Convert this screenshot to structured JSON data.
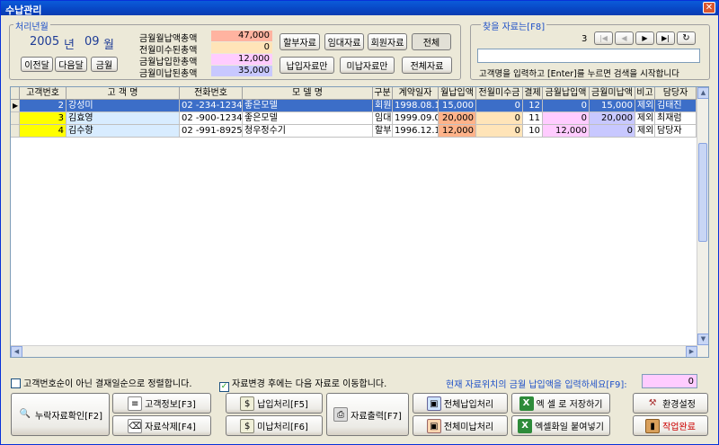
{
  "window": {
    "title": "수납관리",
    "close_glyph": "✕"
  },
  "period": {
    "group_label": "처리년월",
    "year": "2005",
    "year_unit": "년",
    "month": "09",
    "month_unit": "월",
    "prev_month_btn": "이전달",
    "next_month_btn": "다음달",
    "this_month_btn": "금월"
  },
  "summary": {
    "rows": [
      {
        "label": "금월월납액총액",
        "value": "47,000",
        "color": "#ffb3a0"
      },
      {
        "label": "전월미수된총액",
        "value": "0",
        "color": "#ffe4b8"
      },
      {
        "label": "금월납입한총액",
        "value": "12,000",
        "color": "#ffccff"
      },
      {
        "label": "금월미납된총액",
        "value": "35,000",
        "color": "#c8c8ff"
      }
    ]
  },
  "filters": {
    "installment": "할부자료",
    "rental": "임대자료",
    "member": "회원자료",
    "all": "전체",
    "paid_only": "납입자료만",
    "unpaid_only": "미납자료만",
    "all_data": "전체자료"
  },
  "search": {
    "group_label": "찾을 자료는[F8]",
    "counter": "3",
    "nav_first": "|◀",
    "nav_prev": "◀",
    "nav_next": "▶",
    "nav_last": "▶|",
    "nav_refresh": "↻",
    "input_value": "",
    "hint": "고객명을 입력하고 [Enter]를 누르면 검색을 시작합니다"
  },
  "table": {
    "columns": [
      "고객번호",
      "고 객 명",
      "전화번호",
      "모  델  명",
      "구분",
      "계약일자",
      "월납입액",
      "전월미수금",
      "결제",
      "금월납입액",
      "금월미납액",
      "비고",
      "담당자"
    ],
    "rows": [
      {
        "indicator": "▶",
        "id": "2",
        "name": "강성미",
        "phone": "02  -234-1234",
        "model": "좋은모델",
        "type": "회원",
        "date": "1998.08.10",
        "monthly": "15,000",
        "prev_unpaid": "0",
        "pay_day": "12",
        "paid": "0",
        "unpaid": "15,000",
        "note": "제외",
        "manager": "김태진"
      },
      {
        "indicator": "",
        "id": "3",
        "name": "김효영",
        "phone": "02  -900-1234",
        "model": "좋은모델",
        "type": "임대",
        "date": "1999.09.01",
        "monthly": "20,000",
        "prev_unpaid": "0",
        "pay_day": "11",
        "paid": "0",
        "unpaid": "20,000",
        "note": "제외",
        "manager": "최재럼"
      },
      {
        "indicator": "",
        "id": "4",
        "name": "김수향",
        "phone": "02  -991-8925",
        "model": "청우정수기",
        "type": "할부",
        "date": "1996.12.10",
        "monthly": "12,000",
        "prev_unpaid": "0",
        "pay_day": "10",
        "paid": "12,000",
        "unpaid": "0",
        "note": "제외",
        "manager": "담당자"
      }
    ]
  },
  "options": {
    "sort_check": "고객번호순이 아닌 결재일순으로 정렬합니다.",
    "sort_checked": false,
    "move_check": "자료변경 후에는 다음 자료로 이동합니다.",
    "move_checked": true,
    "payment_prompt": "현재 자료위치의 금월 납입액을 입력하세요[F9]:",
    "payment_value": "0"
  },
  "actions": {
    "missing_check": "누락자료확인[F2]",
    "customer_info": "고객정보[F3]",
    "delete": "자료삭제[F4]",
    "pay_process": "납입처리[F5]",
    "unpaid_process": "미납처리[F6]",
    "print": "자료출력[F7]",
    "all_pay": "전체납입처리",
    "all_unpaid": "전체미납처리",
    "excel_save": "엑 셀 로 저장하기",
    "excel_paste": "엑셀화일 붙여넣기",
    "settings": "환경설정",
    "finish": "작업완료"
  }
}
